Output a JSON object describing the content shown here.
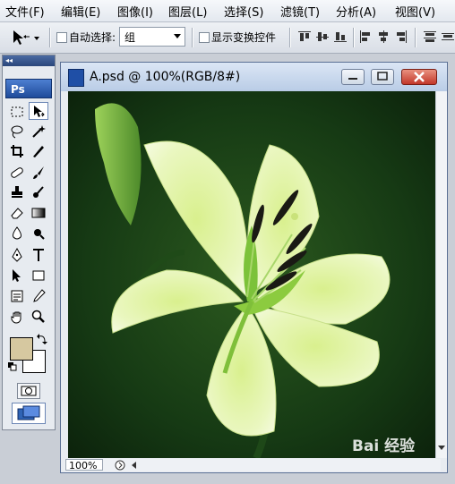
{
  "menu": [
    {
      "name": "menu-file",
      "label": "文件(F)"
    },
    {
      "name": "menu-edit",
      "label": "编辑(E)"
    },
    {
      "name": "menu-image",
      "label": "图像(I)"
    },
    {
      "name": "menu-layer",
      "label": "图层(L)"
    },
    {
      "name": "menu-select",
      "label": "选择(S)"
    },
    {
      "name": "menu-filter",
      "label": "滤镜(T)"
    },
    {
      "name": "menu-analysis",
      "label": "分析(A)"
    },
    {
      "name": "menu-view",
      "label": "视图(V)"
    }
  ],
  "options": {
    "auto_select_label": "自动选择:",
    "auto_select_value": "组",
    "show_transform_label": "显示变换控件"
  },
  "toolbox": {
    "logo": "Ps",
    "collapse": "◂◂",
    "fg_color": "#d6c8a0",
    "bg_color": "#ffffff"
  },
  "document": {
    "title": "A.psd @ 100%(RGB/8#)",
    "zoom": "100%"
  },
  "watermark": "Bai 经验"
}
